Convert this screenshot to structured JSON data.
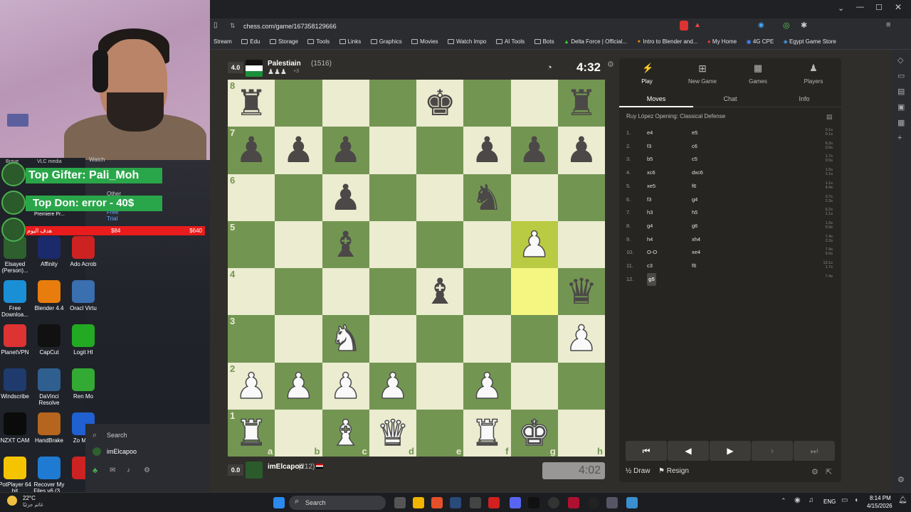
{
  "desktop": {
    "panel_items": [
      "Brave",
      "VLC media",
      "Watch",
      "Other",
      "Free Trial"
    ],
    "icons": [
      {
        "label": "Elsayed (Person)...",
        "color": "#2e5f2e"
      },
      {
        "label": "Affinity",
        "color": "#1b2a6b"
      },
      {
        "label": "Ado Acrob",
        "color": "#c22"
      },
      {
        "label": "Free Downloa...",
        "color": "#1a8fd6"
      },
      {
        "label": "Blender 4.4",
        "color": "#e87d0d"
      },
      {
        "label": "Oracl Virtu",
        "color": "#3a6fb0"
      },
      {
        "label": "PlanetVPN",
        "color": "#d33"
      },
      {
        "label": "CapCut",
        "color": "#111"
      },
      {
        "label": "Logit HI",
        "color": "#2a2"
      },
      {
        "label": "Windscribe",
        "color": "#1f3b6d"
      },
      {
        "label": "DaVinci Resolve",
        "color": "#2f5f8f"
      },
      {
        "label": "Ren Mo",
        "color": "#3a3"
      },
      {
        "label": "NZXT CAM",
        "color": "#0b0b0b"
      },
      {
        "label": "HandBrake",
        "color": "#b5651d"
      },
      {
        "label": "Zo Myin",
        "color": "#2060d0"
      },
      {
        "label": "PotPlayer 64 bit",
        "color": "#f5c400"
      },
      {
        "label": "Recover My Files v6 (3...",
        "color": "#1f7ad1"
      },
      {
        "label": "",
        "color": "#c22"
      }
    ],
    "premiere_label": "Premiere Pr...",
    "start_search": "Search",
    "start_user": "imElcapoo"
  },
  "stream": {
    "top_gifter": "Top Gifter: Pali_Moh",
    "top_don": "Top Don: error - 40$",
    "goal_label": "هدف اليوم",
    "goal_current": "$84",
    "goal_target": "$640"
  },
  "browser": {
    "url": "chess.com/game/167358129666",
    "bookmarks": [
      "Stream",
      "Edu",
      "Storage",
      "Tools",
      "Links",
      "Graphics",
      "Movies",
      "Watch Impo",
      "AI Tools",
      "Bots",
      "Delta Force | Official...",
      "Intro to Blender and...",
      "My Home",
      "4G CPE",
      "Egypt Game Store"
    ]
  },
  "game": {
    "top_player": {
      "eval": "4.0",
      "name": "Palestiain",
      "rating": "(1516)",
      "captured": "+3"
    },
    "bottom_player": {
      "eval": "0.0",
      "name": "imElcapoo",
      "rating": "(212)"
    },
    "top_clock": "4:32",
    "bottom_clock": "4:02",
    "ranks": [
      "8",
      "7",
      "6",
      "5",
      "4",
      "3",
      "2",
      "1"
    ],
    "files": [
      "a",
      "b",
      "c",
      "d",
      "e",
      "f",
      "g",
      "h"
    ],
    "board": [
      [
        "bR",
        "",
        "",
        "",
        "bK",
        "",
        "",
        "bR"
      ],
      [
        "bP",
        "bP",
        "bP",
        "",
        "",
        "bP",
        "bP",
        "bP"
      ],
      [
        "",
        "",
        "bP",
        "",
        "",
        "bN",
        "",
        ""
      ],
      [
        "",
        "",
        "bB",
        "",
        "",
        "",
        "wP",
        ""
      ],
      [
        "",
        "",
        "",
        "",
        "bB",
        "",
        "",
        "bQ"
      ],
      [
        "",
        "",
        "wN",
        "",
        "",
        "",
        "",
        "wP"
      ],
      [
        "wP",
        "wP",
        "wP",
        "wP",
        "",
        "wP",
        "",
        ""
      ],
      [
        "wR",
        "",
        "wB",
        "wQ",
        "",
        "wR",
        "wK",
        ""
      ]
    ]
  },
  "panel": {
    "tabs": [
      "Play",
      "New Game",
      "Games",
      "Players"
    ],
    "subtabs": [
      "Moves",
      "Chat",
      "Info"
    ],
    "opening": "Ruy López Opening: Classical Defense",
    "moves": [
      {
        "n": "1.",
        "w": "e4",
        "b": "e5",
        "tw": "0.1s",
        "tb": "0.1s"
      },
      {
        "n": "2.",
        "w": "f3",
        "b": "c6",
        "tw": "6.2s",
        "tb": "0.5s"
      },
      {
        "n": "3.",
        "w": "b5",
        "b": "c5",
        "tw": "1.7s",
        "tb": "0.5s"
      },
      {
        "n": "4.",
        "w": "xc6",
        "b": "dxc6",
        "tw": "1.5s",
        "tb": "1.1s"
      },
      {
        "n": "5.",
        "w": "xe5",
        "b": "f6",
        "tw": "1.1s",
        "tb": "4.4s"
      },
      {
        "n": "6.",
        "w": "f3",
        "b": "g4",
        "tw": "3.7s",
        "tb": "2.3s"
      },
      {
        "n": "7.",
        "w": "h3",
        "b": "h5",
        "tw": "6.2s",
        "tb": "1.1s"
      },
      {
        "n": "8.",
        "w": "g4",
        "b": "g6",
        "tw": "1.3s",
        "tb": "0.9s"
      },
      {
        "n": "9.",
        "w": "h4",
        "b": "xh4",
        "tw": "7.4s",
        "tb": "2.2s"
      },
      {
        "n": "10.",
        "w": "O-O",
        "b": "xe4",
        "tw": "7.4s",
        "tb": "6.0s"
      },
      {
        "n": "11.",
        "w": "c3",
        "b": "f6",
        "tw": "13.1s",
        "tb": "1.7s"
      },
      {
        "n": "12.",
        "w": "g5",
        "b": "",
        "tw": "7.4s",
        "tb": ""
      }
    ],
    "draw": "Draw",
    "resign": "Resign"
  },
  "taskbar": {
    "weather_temp": "22°C",
    "weather_desc": "غائم جزئيًا",
    "search": "Search",
    "lang": "ENG",
    "time": "8:14 PM",
    "date": "4/15/2026"
  }
}
